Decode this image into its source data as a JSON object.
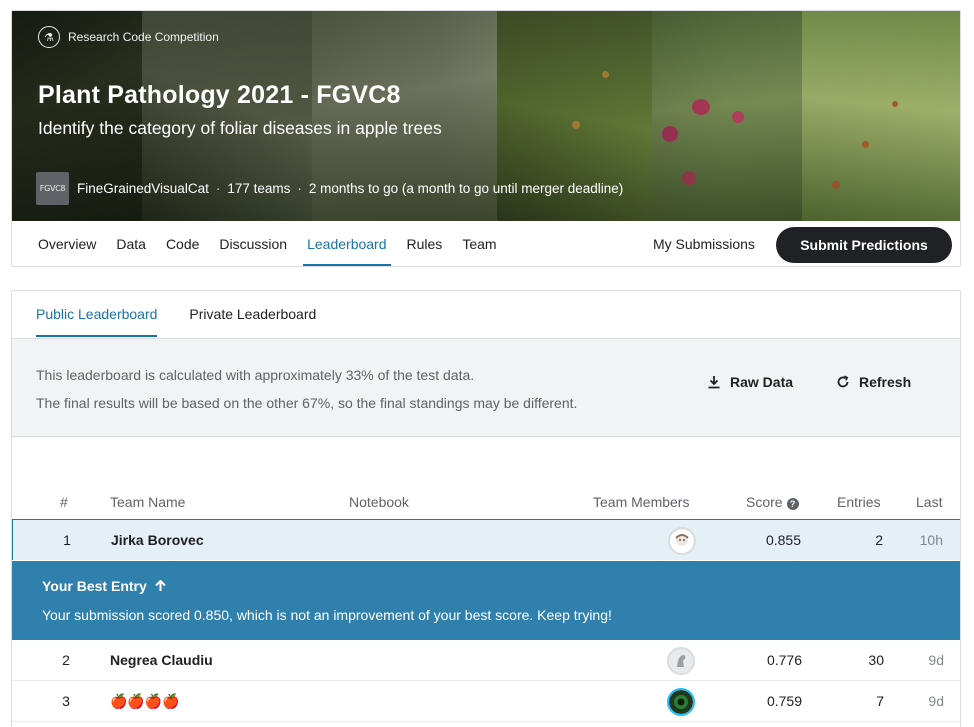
{
  "header": {
    "competition_type": "Research Code Competition",
    "title": "Plant Pathology 2021 - FGVC8",
    "subtitle": "Identify the category of foliar diseases in apple trees",
    "org_avatar_text": "FGVC8",
    "org_name": "FineGrainedVisualCat",
    "teams": "177 teams",
    "time_left": "2 months to go (a month to go until merger deadline)",
    "separator": "·"
  },
  "nav": {
    "tabs": [
      "Overview",
      "Data",
      "Code",
      "Discussion",
      "Leaderboard",
      "Rules",
      "Team"
    ],
    "active_tab": "Leaderboard",
    "my_submissions": "My Submissions",
    "submit_label": "Submit Predictions"
  },
  "leaderboard": {
    "tabs": [
      "Public Leaderboard",
      "Private Leaderboard"
    ],
    "active_tab": "Public Leaderboard",
    "info_line_1": "This leaderboard is calculated with approximately 33% of the test data.",
    "info_line_2": "The final results will be based on the other 67%, so the final standings may be different.",
    "raw_data_label": "Raw Data",
    "refresh_label": "Refresh",
    "columns": {
      "rank": "#",
      "team_name": "Team Name",
      "notebook": "Notebook",
      "team_members": "Team Members",
      "score": "Score",
      "entries": "Entries",
      "last": "Last"
    },
    "rows": [
      {
        "rank": "1",
        "team": "Jirka Borovec",
        "score": "0.855",
        "entries": "2",
        "last": "10h"
      },
      {
        "rank": "2",
        "team": "Negrea Claudiu",
        "score": "0.776",
        "entries": "30",
        "last": "9d"
      },
      {
        "rank": "3",
        "team": "🍎🍎🍎🍎",
        "score": "0.759",
        "entries": "7",
        "last": "9d"
      }
    ],
    "best_entry": {
      "title": "Your Best Entry",
      "message": "Your submission scored 0.850, which is not an improvement of your best score. Keep trying!"
    }
  },
  "colors": {
    "accent": "#1a73a8",
    "best_entry_bg": "#2f80ad",
    "highlight_row_bg": "#e4f0f6",
    "submit_button_bg": "#202124"
  }
}
